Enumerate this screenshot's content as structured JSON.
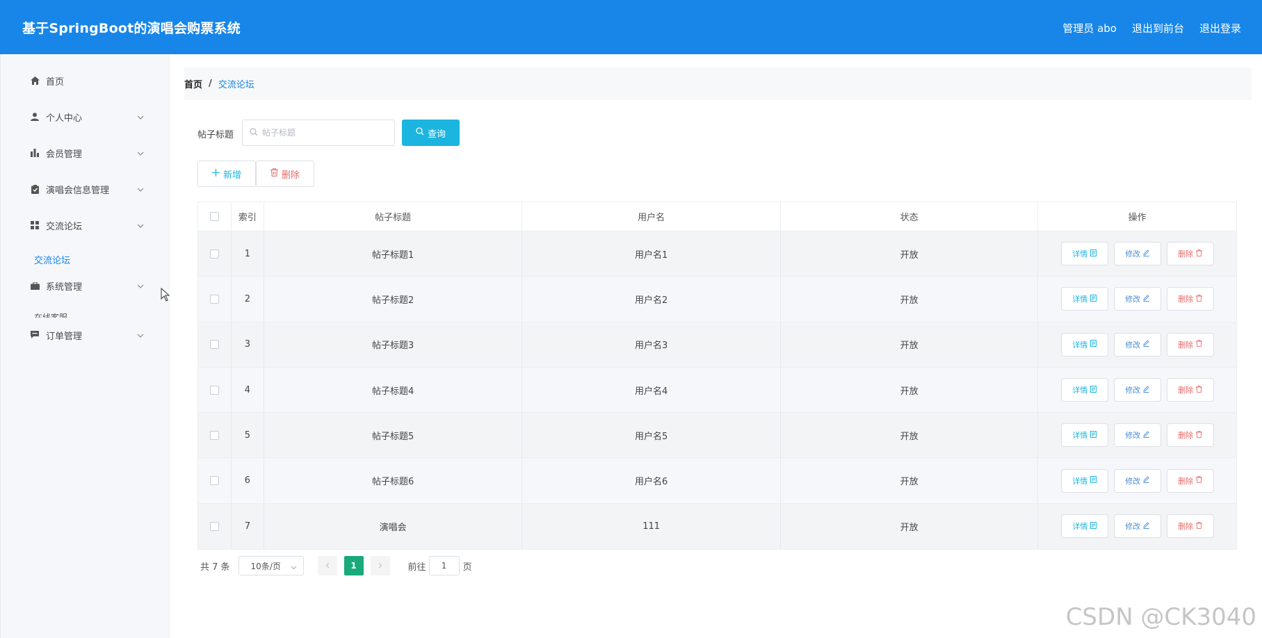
{
  "header": {
    "title": "基于SpringBoot的演唱会购票系统",
    "admin_label": "管理员 abo",
    "front_link": "退出到前台",
    "logout_link": "退出登录"
  },
  "sidebar": {
    "items": [
      {
        "label": "首页",
        "icon": "home-icon"
      },
      {
        "label": "个人中心",
        "icon": "user-icon"
      },
      {
        "label": "会员管理",
        "icon": "bar-chart-icon"
      },
      {
        "label": "演唱会信息管理",
        "icon": "clipboard-icon"
      },
      {
        "label": "交流论坛",
        "icon": "grid-icon"
      },
      {
        "label": "系统管理",
        "icon": "briefcase-icon"
      },
      {
        "label": "订单管理",
        "icon": "message-icon"
      }
    ],
    "active_sub": "交流论坛",
    "clipped_sub": "在线客服"
  },
  "breadcrumb": {
    "home": "首页",
    "sep": "/",
    "current": "交流论坛"
  },
  "search": {
    "label": "帖子标题",
    "placeholder": "帖子标题",
    "value": "",
    "button": "查询"
  },
  "toolbar": {
    "add": "新增",
    "delete": "删除"
  },
  "table": {
    "headers": [
      "索引",
      "帖子标题",
      "用户名",
      "状态",
      "操作"
    ],
    "rows": [
      {
        "index": "1",
        "title": "帖子标题1",
        "user": "用户名1",
        "status": "开放"
      },
      {
        "index": "2",
        "title": "帖子标题2",
        "user": "用户名2",
        "status": "开放"
      },
      {
        "index": "3",
        "title": "帖子标题3",
        "user": "用户名3",
        "status": "开放"
      },
      {
        "index": "4",
        "title": "帖子标题4",
        "user": "用户名4",
        "status": "开放"
      },
      {
        "index": "5",
        "title": "帖子标题5",
        "user": "用户名5",
        "status": "开放"
      },
      {
        "index": "6",
        "title": "帖子标题6",
        "user": "用户名6",
        "status": "开放"
      },
      {
        "index": "7",
        "title": "演唱会",
        "user": "111",
        "status": "开放"
      }
    ],
    "actions": {
      "detail": "详情",
      "edit": "修改",
      "remove": "删除"
    }
  },
  "pagination": {
    "total": "共 7 条",
    "page_size": "10条/页",
    "current": "1",
    "goto_prefix": "前往",
    "goto_value": "1",
    "goto_suffix": "页"
  },
  "watermark": "CSDN @CK3040",
  "colors": {
    "header_bg": "#1786e8",
    "query_btn": "#1cb5e0",
    "active_page": "#19a97b",
    "danger": "#e86a6a"
  }
}
